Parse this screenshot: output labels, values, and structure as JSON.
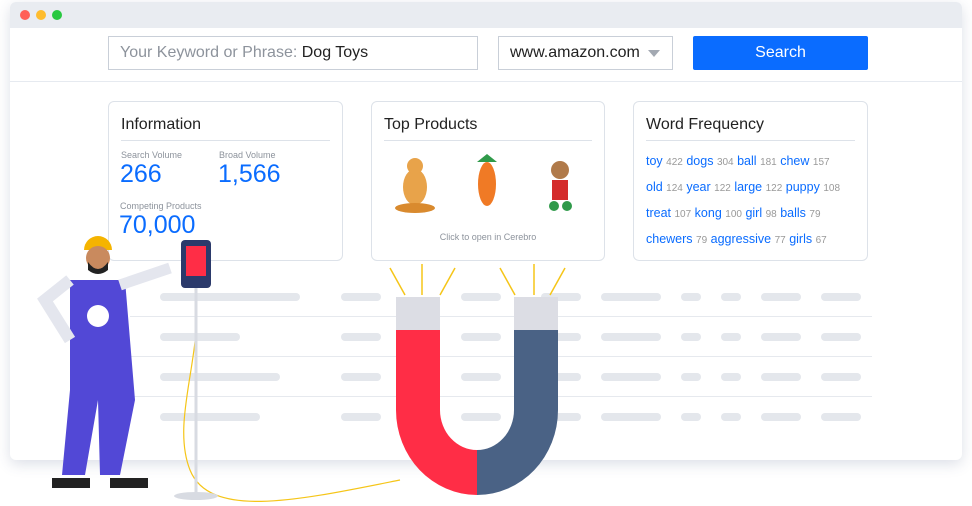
{
  "search": {
    "placeholder": "Your Keyword or Phrase:",
    "value": "Dog Toys",
    "marketplace": "www.amazon.com",
    "button": "Search"
  },
  "information": {
    "title": "Information",
    "search_volume_label": "Search Volume",
    "search_volume": "266",
    "broad_volume_label": "Broad Volume",
    "broad_volume": "1,566",
    "competing_label": "Competing Products",
    "competing": "70,000"
  },
  "top_products": {
    "title": "Top Products",
    "hint": "Click to open in Cerebro"
  },
  "word_frequency": {
    "title": "Word Frequency",
    "words": [
      {
        "w": "toy",
        "n": "422"
      },
      {
        "w": "dogs",
        "n": "304"
      },
      {
        "w": "ball",
        "n": "181"
      },
      {
        "w": "chew",
        "n": "157"
      },
      {
        "w": "old",
        "n": "124"
      },
      {
        "w": "year",
        "n": "122"
      },
      {
        "w": "large",
        "n": "122"
      },
      {
        "w": "puppy",
        "n": "108"
      },
      {
        "w": "treat",
        "n": "107"
      },
      {
        "w": "kong",
        "n": "100"
      },
      {
        "w": "girl",
        "n": "98"
      },
      {
        "w": "balls",
        "n": "79"
      },
      {
        "w": "chewers",
        "n": "79"
      },
      {
        "w": "aggressive",
        "n": "77"
      },
      {
        "w": "girls",
        "n": "67"
      }
    ]
  },
  "colors": {
    "accent": "#0a6cff",
    "magnet_red": "#ff2d46",
    "magnet_blue": "#4a6285",
    "worker_overalls": "#5248d6"
  }
}
